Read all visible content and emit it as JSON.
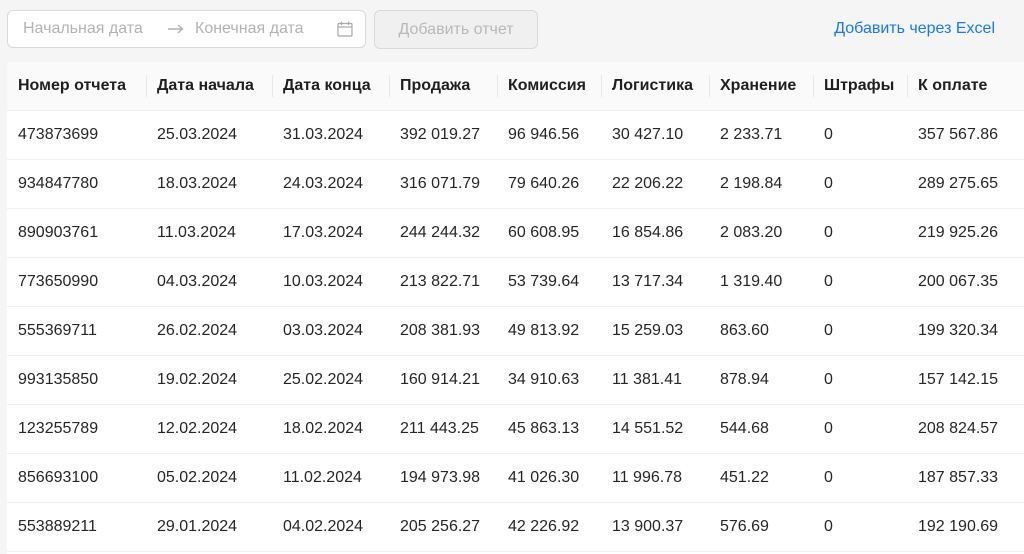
{
  "toolbar": {
    "start_placeholder": "Начальная дата",
    "end_placeholder": "Конечная дата",
    "add_report_label": "Добавить отчет",
    "excel_link_label": "Добавить через Excel"
  },
  "colors": {
    "link": "#1677ff",
    "disabled_text": "#b8b8b8",
    "header_bg": "#fafafa",
    "page_bg": "#f5f5f5"
  },
  "icons": {
    "separator": "arrow-right-icon",
    "calendar": "calendar-icon"
  },
  "table": {
    "columns": [
      "Номер отчета",
      "Дата начала",
      "Дата конца",
      "Продажа",
      "Комиссия",
      "Логистика",
      "Хранение",
      "Штрафы",
      "К оплате"
    ],
    "rows": [
      [
        "473873699",
        "25.03.2024",
        "31.03.2024",
        "392 019.27",
        "96 946.56",
        "30 427.10",
        "2 233.71",
        "0",
        "357 567.86"
      ],
      [
        "934847780",
        "18.03.2024",
        "24.03.2024",
        "316 071.79",
        "79 640.26",
        "22 206.22",
        "2 198.84",
        "0",
        "289 275.65"
      ],
      [
        "890903761",
        "11.03.2024",
        "17.03.2024",
        "244 244.32",
        "60 608.95",
        "16 854.86",
        "2 083.20",
        "0",
        "219 925.26"
      ],
      [
        "773650990",
        "04.03.2024",
        "10.03.2024",
        "213 822.71",
        "53 739.64",
        "13 717.34",
        "1 319.40",
        "0",
        "200 067.35"
      ],
      [
        "555369711",
        "26.02.2024",
        "03.03.2024",
        "208 381.93",
        "49 813.92",
        "15 259.03",
        "863.60",
        "0",
        "199 320.34"
      ],
      [
        "993135850",
        "19.02.2024",
        "25.02.2024",
        "160 914.21",
        "34 910.63",
        "11 381.41",
        "878.94",
        "0",
        "157 142.15"
      ],
      [
        "123255789",
        "12.02.2024",
        "18.02.2024",
        "211 443.25",
        "45 863.13",
        "14 551.52",
        "544.68",
        "0",
        "208 824.57"
      ],
      [
        "856693100",
        "05.02.2024",
        "11.02.2024",
        "194 973.98",
        "41 026.30",
        "11 996.78",
        "451.22",
        "0",
        "187 857.33"
      ],
      [
        "553889211",
        "29.01.2024",
        "04.02.2024",
        "205 256.27",
        "42 226.92",
        "13 900.37",
        "576.69",
        "0",
        "192 190.69"
      ]
    ]
  }
}
